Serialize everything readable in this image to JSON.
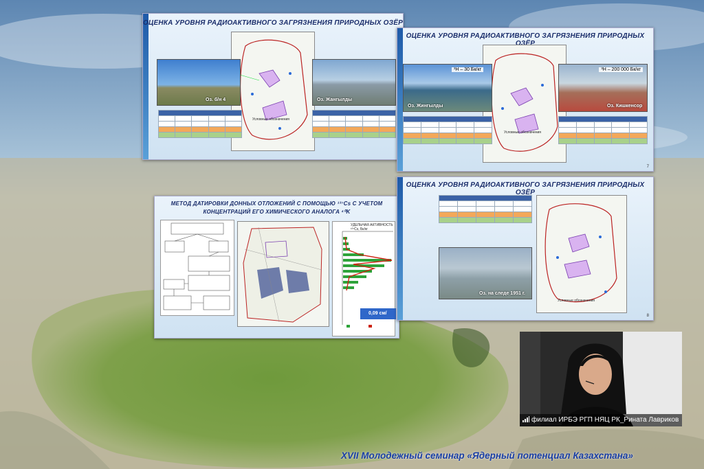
{
  "slides": {
    "s1": {
      "title": "ОЦЕНКА УРОВНЯ  РАДИОАКТИВНОГО ЗАГРЯЗНЕНИЯ ПРИРОДНЫХ ОЗЁР",
      "photo_left_caption": "Оз. б/н 4",
      "photo_right_caption": "Оз. Жангылды",
      "legend_title": "Условные обозначения"
    },
    "s2": {
      "title": "ОЦЕНКА УРОВНЯ  РАДИОАКТИВНОГО ЗАГРЯЗНЕНИЯ ПРИРОДНЫХ ОЗЁР",
      "photo_left_caption": "Оз. Жингылды",
      "photo_left_tag": "³H – 30 Бк/кг",
      "photo_right_caption": "Оз. Кишкенсор",
      "photo_right_tag": "³H – 200 000 Бк/кг",
      "legend_title": "Условные обозначения",
      "page": "7"
    },
    "s3": {
      "title_line1": "МЕТОД ДАТИРОВКИ ДОННЫХ ОТЛОЖЕНИЙ С ПОМОЩЬЮ ¹³⁷Cs С УЧЕТОМ",
      "title_line2": "КОНЦЕНТРАЦИЙ ЕГО ХИМИЧЕСКОГО АНАЛОГА ⁴⁰K",
      "chart_header": "УДЕЛЬНАЯ АКТИВНОСТЬ ¹³⁷Cs, Бк/кг",
      "badge": "0,09 см/"
    },
    "s4": {
      "title": "ОЦЕНКА УРОВНЯ  РАДИОАКТИВНОГО ЗАГРЯЗНЕНИЯ ПРИРОДНЫХ ОЗЁР",
      "photo_caption": "Оз. на следе 1951 г.",
      "legend_title": "Условные обозначения",
      "page": "8"
    }
  },
  "webcam": {
    "participant_name": "филиал ИРБЭ РГП НЯЦ РК_Рината Лавриков",
    "icon": "signal-bars-icon"
  },
  "footer": {
    "text": "XVII Молодежный семинар «Ядерный потенциал Казахстана»"
  },
  "colors": {
    "title_blue": "#1b2e6b",
    "footer_blue": "#1a3fa6",
    "table_header": "#3b62a6",
    "row_orange": "#f3a85a",
    "row_green": "#a8d18b"
  }
}
